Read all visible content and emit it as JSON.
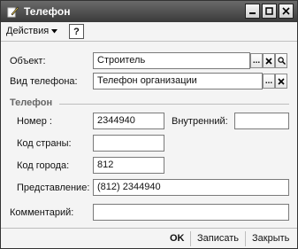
{
  "window": {
    "title": "Телефон"
  },
  "toolbar": {
    "actions_label": "Действия",
    "help_label": "?"
  },
  "form": {
    "object_label": "Объект:",
    "object_value": "Строитель",
    "phone_type_label": "Вид телефона:",
    "phone_type_value": "Телефон организации",
    "section_title": "Телефон",
    "number_label": "Номер :",
    "number_value": "2344940",
    "internal_label": "Внутренний:",
    "internal_value": "",
    "country_code_label": "Код страны:",
    "country_code_value": "",
    "city_code_label": "Код города:",
    "city_code_value": "812",
    "representation_label": "Представление:",
    "representation_value": "(812) 2344940",
    "comment_label": "Комментарий:",
    "comment_value": ""
  },
  "buttons": {
    "ok": "OK",
    "save": "Записать",
    "close": "Закрыть"
  },
  "icons": {
    "ellipsis": "...",
    "clear": "×",
    "window_minimize": "_",
    "window_maximize": "□",
    "window_close": "×"
  }
}
